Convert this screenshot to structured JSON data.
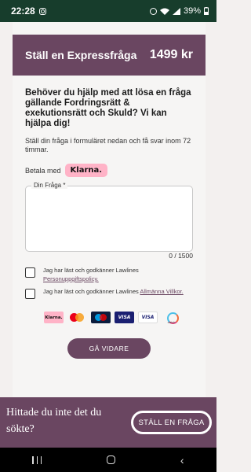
{
  "status_bar": {
    "time": "22:28",
    "battery": "39%",
    "icons": [
      "instagram-icon",
      "alarm-icon",
      "wifi-icon",
      "signal-icon",
      "battery-icon"
    ]
  },
  "card": {
    "title": "Ställ en Expressfråga",
    "price": "1499 kr",
    "headline": "Behöver du hjälp med att lösa en fråga gällande Fordringsrätt & exekutionsrätt och Skuld? Vi kan hjälpa dig!",
    "subtext": "Ställ din fråga i formuläret nedan och få svar inom 72 timmar.",
    "pay_with_label": "Betala med",
    "klarna_label": "Klarna.",
    "textarea_label": "Din Fråga *",
    "textarea_value": "",
    "counter": "0 / 1500",
    "consent_privacy_text": "Jag har läst och godkänner Lawlines",
    "consent_privacy_link": "Personuppgiftspolicy.",
    "consent_terms_text": "Jag har läst och godkänner Lawlines",
    "consent_terms_link": "Allmänna Villkor.",
    "payment_methods": {
      "klarna": "Klarna.",
      "visa": "VISA",
      "visa_electron": "VISA",
      "swish": "swish"
    },
    "submit_label": "GÅ VIDARE"
  },
  "banner": {
    "text": "Hittade du inte det du sökte?",
    "button_label": "STÄLL EN FRÅGA"
  },
  "colors": {
    "status_bar": "#173d2c",
    "brand_plum": "#6a4661",
    "klarna_pink": "#ffb3c7",
    "background": "#f3f0ef"
  }
}
